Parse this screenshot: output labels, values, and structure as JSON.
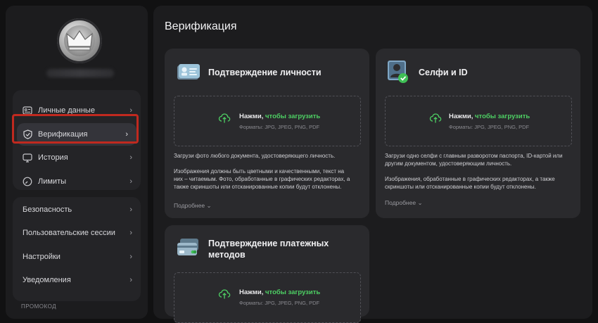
{
  "sidebar": {
    "group1": [
      {
        "label": "Личные данные",
        "icon": "id-card-icon"
      },
      {
        "label": "Верификация",
        "icon": "shield-icon"
      },
      {
        "label": "История",
        "icon": "monitor-icon"
      },
      {
        "label": "Лимиты",
        "icon": "gauge-icon"
      }
    ],
    "group2": [
      {
        "label": "Безопасность"
      },
      {
        "label": "Пользовательские сессии"
      },
      {
        "label": "Настройки"
      },
      {
        "label": "Уведомления"
      }
    ],
    "promo_label": "ПРОМОКОД"
  },
  "main": {
    "title": "Верификация",
    "upload_main": "Нажми,",
    "upload_link": "чтобы загрузить",
    "upload_formats": "Форматы: JPG, JPEG, PNG, PDF",
    "more_label": "Подробнее",
    "cards": {
      "identity": {
        "title": "Подтверждение личности",
        "desc1": "Загрузи фото любого документа, удостоверяющего личность.",
        "desc2_l1": "Изображения должны быть цветными и качественными, текст на",
        "desc2_l2": "них – читаемым. Фото, обработанные в графических редакторах, а",
        "desc2_l3": "также скриншоты или отсканированные копии будут отклонены."
      },
      "selfie": {
        "title": "Селфи и ID",
        "desc1_l1": "Загрузи одно селфи с главным разворотом паспорта, ID-картой или",
        "desc1_l2": "другим документом, удостоверяющим личность.",
        "desc2_l1": "Изображения, обработанные в графических редакторах, а также",
        "desc2_l2": "скриншоты или отсканированные копии будут отклонены."
      },
      "payment": {
        "title_l1": "Подтверждение платежных",
        "title_l2": "методов"
      }
    }
  },
  "colors": {
    "accent_green": "#4ed164",
    "highlight_red": "#c0291f"
  }
}
